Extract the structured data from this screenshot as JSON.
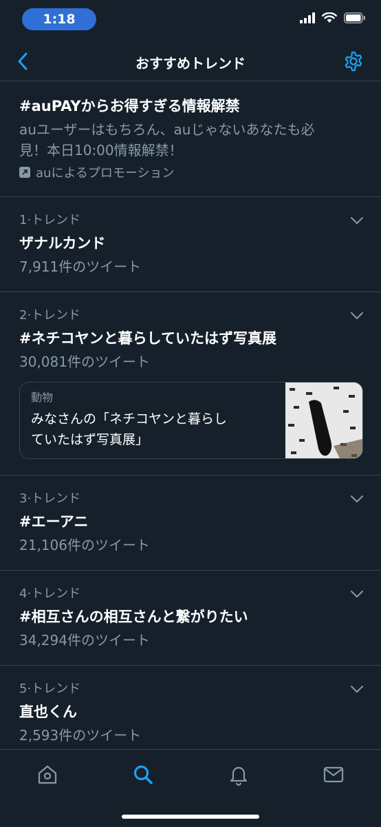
{
  "status": {
    "time": "1:18"
  },
  "header": {
    "title": "おすすめトレンド"
  },
  "promo": {
    "title": "#auPAYからお得すぎる情報解禁",
    "desc_line1": "auユーザーはもちろん、auじゃないあなたも必",
    "desc_line2": "見！本日10:00情報解禁！",
    "by": "auによるプロモーション"
  },
  "trends": [
    {
      "rank": "1·トレンド",
      "name": "ザナルカンド",
      "count": "7,911件のツイート"
    },
    {
      "rank": "2·トレンド",
      "name": "#ネチコヤンと暮らしていたはず写真展",
      "count": "30,081件のツイート",
      "card": {
        "category": "動物",
        "line1": "みなさんの「ネチコヤンと暮らし",
        "line2": "ていたはず写真展」"
      }
    },
    {
      "rank": "3·トレンド",
      "name": "#エーアニ",
      "count": "21,106件のツイート"
    },
    {
      "rank": "4·トレンド",
      "name": "#相互さんの相互さんと繋がりたい",
      "count": "34,294件のツイート"
    },
    {
      "rank": "5·トレンド",
      "name": "直也くん",
      "count": "2,593件のツイート"
    }
  ],
  "icons": {
    "back": "chevron-left-icon",
    "settings": "gear-icon",
    "tabs": [
      "home-icon",
      "search-icon",
      "bell-icon",
      "mail-icon"
    ]
  },
  "colors": {
    "accent": "#1da1f2",
    "background": "#15202b",
    "secondary_text": "#8899a6",
    "divider": "#38444d"
  }
}
